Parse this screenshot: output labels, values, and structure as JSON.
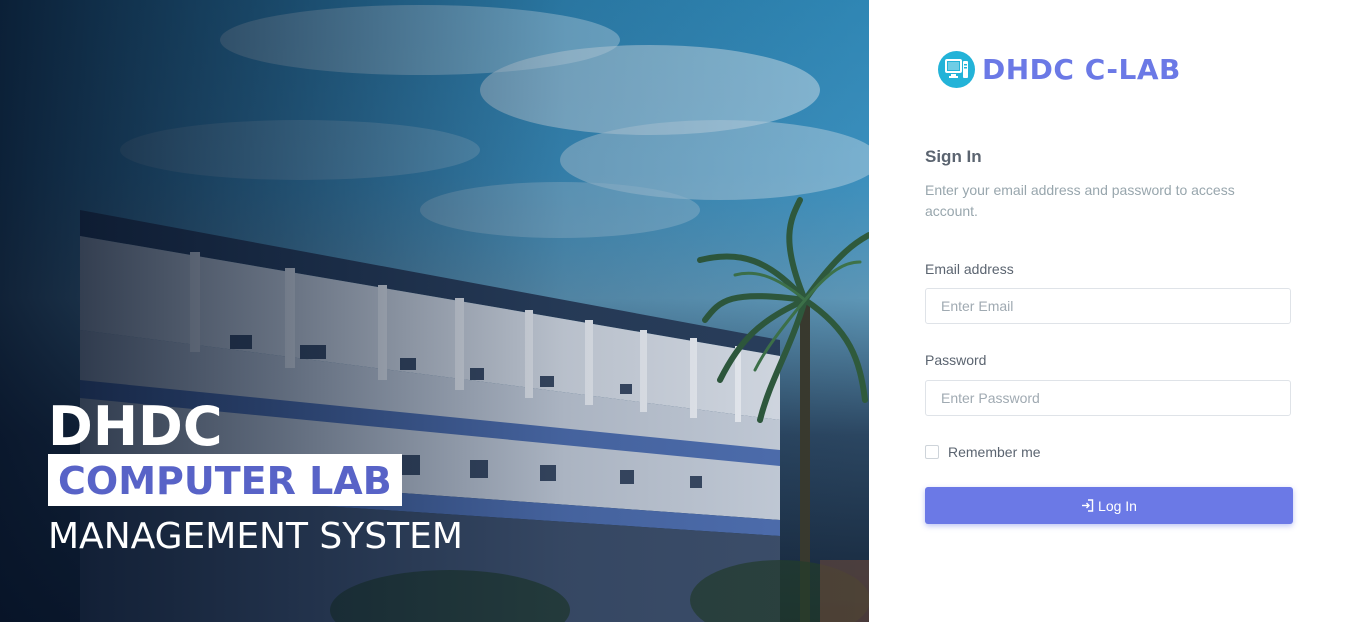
{
  "hero": {
    "title": "DHDC",
    "subtitle": "COMPUTER LAB",
    "tagline": "MANAGEMENT SYSTEM"
  },
  "brand": {
    "icon": "computer-monitor-icon",
    "name": "DHDC C-LAB",
    "icon_color": "#23b3d8",
    "name_color": "#6b79e6"
  },
  "signin": {
    "title": "Sign In",
    "description": "Enter your email address and password to access account."
  },
  "form": {
    "email_label": "Email address",
    "email_placeholder": "Enter Email",
    "email_value": "",
    "password_label": "Password",
    "password_placeholder": "Enter Password",
    "password_value": "",
    "remember_label": "Remember me",
    "remember_checked": false,
    "login_label": "Log In",
    "login_icon": "login-arrow-icon"
  },
  "colors": {
    "accent": "#6b79e6",
    "text": "#5b6470",
    "muted": "#98a6ad"
  }
}
